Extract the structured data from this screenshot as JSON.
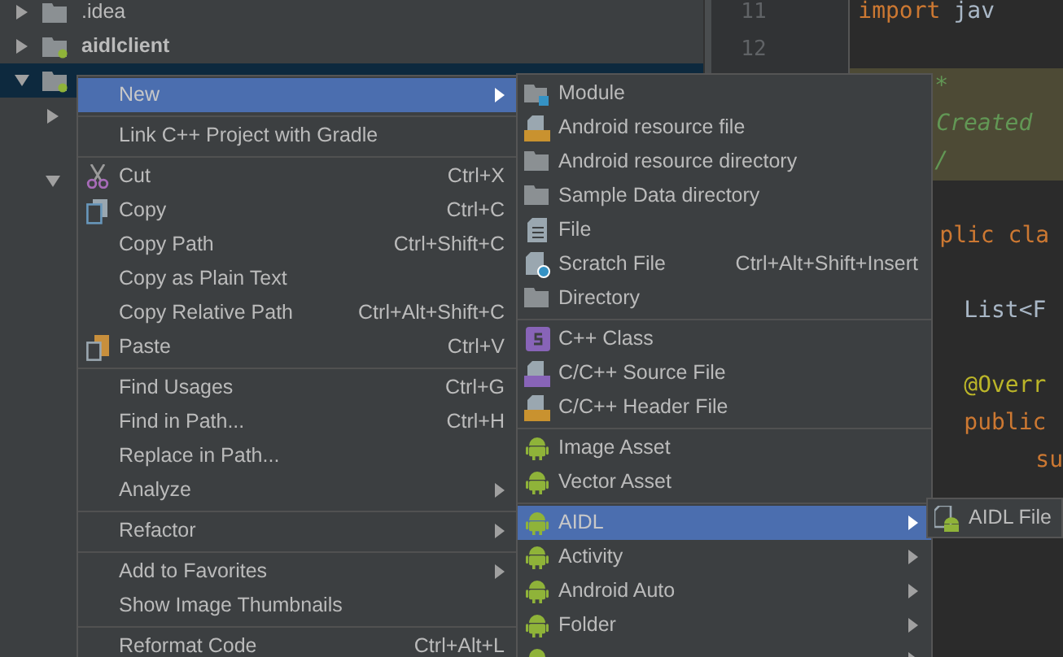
{
  "project_tree": {
    "items": [
      {
        "label": ".idea",
        "bold": false,
        "expanded": false,
        "selected": false,
        "module": false
      },
      {
        "label": "aidlclient",
        "bold": true,
        "expanded": false,
        "selected": false,
        "module": true
      },
      {
        "expanded": true,
        "selected": true,
        "module": true,
        "children": [
          {
            "expanded": false
          },
          {
            "expanded": true
          }
        ]
      }
    ]
  },
  "editor": {
    "line_numbers": [
      "11",
      "12"
    ],
    "lines": [
      {
        "kind": "code",
        "tokens": [
          {
            "text": "import",
            "kind": "keyword"
          },
          {
            "text": "jav",
            "kind": "plain"
          }
        ]
      },
      {
        "kind": "code"
      },
      {
        "kind": "doc",
        "tokens": [
          {
            "text": "*",
            "kind": "comment"
          }
        ]
      },
      {
        "kind": "doc",
        "tokens": [
          {
            "text": "Created",
            "kind": "comment"
          }
        ]
      },
      {
        "kind": "doc",
        "tokens": [
          {
            "text": "/",
            "kind": "comment"
          }
        ]
      },
      {
        "kind": "code"
      },
      {
        "kind": "code",
        "tokens": [
          {
            "text": "plic cla",
            "kind": "keyword"
          }
        ]
      },
      {
        "kind": "code"
      },
      {
        "kind": "code",
        "tokens": [
          {
            "text": "List<F",
            "kind": "plain"
          }
        ]
      },
      {
        "kind": "code"
      },
      {
        "kind": "code",
        "tokens": [
          {
            "text": "@Overr",
            "kind": "annotation"
          }
        ]
      },
      {
        "kind": "code",
        "tokens": [
          {
            "text": "public",
            "kind": "keyword"
          }
        ]
      },
      {
        "kind": "code",
        "tokens": [
          {
            "text": "su",
            "kind": "keyword"
          }
        ]
      }
    ]
  },
  "context_menu": {
    "items": [
      {
        "kind": "item",
        "label": "New",
        "submenu": true,
        "selected": true
      },
      {
        "kind": "separator"
      },
      {
        "kind": "item",
        "label": "Link C++ Project with Gradle",
        "submenu": false,
        "selected": false
      },
      {
        "kind": "separator"
      },
      {
        "kind": "item",
        "label": "Cut",
        "shortcut": "Ctrl+X",
        "submenu": false,
        "selected": false
      },
      {
        "kind": "item",
        "label": "Copy",
        "shortcut": "Ctrl+C",
        "submenu": false,
        "selected": false
      },
      {
        "kind": "item",
        "label": "Copy Path",
        "shortcut": "Ctrl+Shift+C",
        "submenu": false,
        "selected": false
      },
      {
        "kind": "item",
        "label": "Copy as Plain Text",
        "submenu": false,
        "selected": false
      },
      {
        "kind": "item",
        "label": "Copy Relative Path",
        "shortcut": "Ctrl+Alt+Shift+C",
        "submenu": false,
        "selected": false
      },
      {
        "kind": "item",
        "label": "Paste",
        "shortcut": "Ctrl+V",
        "submenu": false,
        "selected": false
      },
      {
        "kind": "separator"
      },
      {
        "kind": "item",
        "label": "Find Usages",
        "shortcut": "Ctrl+G",
        "submenu": false,
        "selected": false
      },
      {
        "kind": "item",
        "label": "Find in Path...",
        "shortcut": "Ctrl+H",
        "submenu": false,
        "selected": false
      },
      {
        "kind": "item",
        "label": "Replace in Path...",
        "submenu": false,
        "selected": false
      },
      {
        "kind": "item",
        "label": "Analyze",
        "submenu": true,
        "selected": false
      },
      {
        "kind": "separator"
      },
      {
        "kind": "item",
        "label": "Refactor",
        "submenu": true,
        "selected": false
      },
      {
        "kind": "separator"
      },
      {
        "kind": "item",
        "label": "Add to Favorites",
        "submenu": true,
        "selected": false
      },
      {
        "kind": "item",
        "label": "Show Image Thumbnails",
        "submenu": false,
        "selected": false
      },
      {
        "kind": "separator"
      },
      {
        "kind": "item",
        "label": "Reformat Code",
        "shortcut": "Ctrl+Alt+L",
        "submenu": false,
        "selected": false
      }
    ]
  },
  "new_submenu": {
    "items": [
      {
        "kind": "item",
        "label": "Module",
        "submenu": false,
        "selected": false
      },
      {
        "kind": "item",
        "label": "Android resource file",
        "submenu": false,
        "selected": false
      },
      {
        "kind": "item",
        "label": "Android resource directory",
        "submenu": false,
        "selected": false
      },
      {
        "kind": "item",
        "label": "Sample Data directory",
        "submenu": false,
        "selected": false
      },
      {
        "kind": "item",
        "label": "File",
        "submenu": false,
        "selected": false
      },
      {
        "kind": "item",
        "label": "Scratch File",
        "shortcut": "Ctrl+Alt+Shift+Insert",
        "submenu": false,
        "selected": false
      },
      {
        "kind": "item",
        "label": "Directory",
        "submenu": false,
        "selected": false
      },
      {
        "kind": "separator"
      },
      {
        "kind": "item",
        "label": "C++ Class",
        "submenu": false,
        "selected": false
      },
      {
        "kind": "item",
        "label": "C/C++ Source File",
        "submenu": false,
        "selected": false
      },
      {
        "kind": "item",
        "label": "C/C++ Header File",
        "submenu": false,
        "selected": false
      },
      {
        "kind": "separator"
      },
      {
        "kind": "item",
        "label": "Image Asset",
        "submenu": false,
        "selected": false
      },
      {
        "kind": "item",
        "label": "Vector Asset",
        "submenu": false,
        "selected": false
      },
      {
        "kind": "separator"
      },
      {
        "kind": "item",
        "label": "AIDL",
        "submenu": true,
        "selected": true
      },
      {
        "kind": "item",
        "label": "Activity",
        "submenu": true,
        "selected": false
      },
      {
        "kind": "item",
        "label": "Android Auto",
        "submenu": true,
        "selected": false
      },
      {
        "kind": "item",
        "label": "Folder",
        "submenu": true,
        "selected": false
      },
      {
        "kind": "item",
        "submenu": true,
        "selected": false
      }
    ]
  },
  "aidl_submenu": {
    "items": [
      {
        "kind": "item",
        "label": "AIDL File",
        "selected": false
      }
    ]
  }
}
